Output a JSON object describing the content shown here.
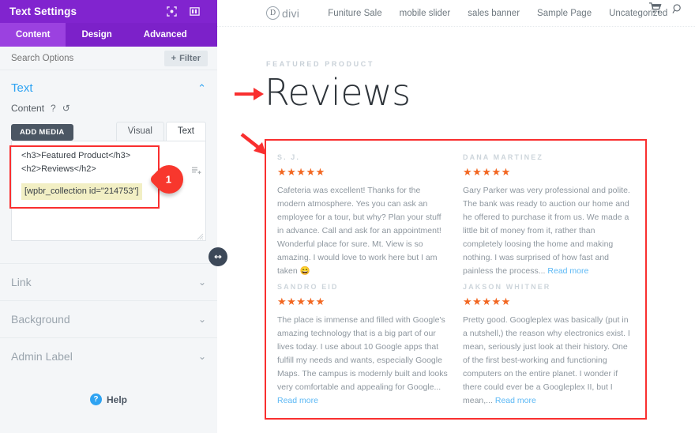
{
  "settings_panel": {
    "title": "Text Settings",
    "header_icons": [
      {
        "name": "focus-target-icon"
      },
      {
        "name": "split-panel-icon"
      }
    ],
    "tabs": [
      {
        "label": "Content",
        "active": true
      },
      {
        "label": "Design",
        "active": false
      },
      {
        "label": "Advanced",
        "active": false
      }
    ],
    "search": {
      "placeholder": "Search Options",
      "value": ""
    },
    "filter_button": {
      "label": "Filter",
      "plus": "+"
    },
    "text_section": {
      "title": "Text",
      "collapse_chevron": "⌃",
      "content_label": "Content",
      "help_mark": "?",
      "undo_mark": "↺",
      "add_media_label": "ADD MEDIA",
      "editor_tabs": [
        {
          "label": "Visual",
          "active": false
        },
        {
          "label": "Text",
          "active": true
        }
      ],
      "code_lines": [
        "<h3>Featured Product</h3>",
        "<h2>Reviews</h2>"
      ],
      "shortcode": "[wpbr_collection id=\"214753\"]",
      "annotation_badge": "1"
    },
    "accordion": [
      {
        "label": "Link",
        "chevron": "⌄"
      },
      {
        "label": "Background",
        "chevron": "⌄"
      },
      {
        "label": "Admin Label",
        "chevron": "⌄"
      }
    ],
    "help": {
      "icon_label": "?",
      "label": "Help"
    }
  },
  "page": {
    "logo": {
      "mark": "D",
      "text": "divi"
    },
    "nav_items": [
      "Funiture Sale",
      "mobile slider",
      "sales banner",
      "Sample Page",
      "Uncategorized"
    ],
    "nav_icons": [
      {
        "name": "cart-icon"
      },
      {
        "name": "search-icon"
      }
    ],
    "eyebrow": "FEATURED PRODUCT",
    "title": "Reviews",
    "reviews": [
      {
        "author": "S. J.",
        "stars": "★★★★★",
        "rating": 5,
        "body": "Cafeteria was excellent! Thanks for the modern atmosphere. Yes you can ask an employee for a tour, but why? Plan your stuff in advance. Call and ask for an appointment! Wonderful place for sure. Mt. View is so amazing. I would love to work here but I am taken 😄",
        "read_more": ""
      },
      {
        "author": "DANA MARTINEZ",
        "stars": "★★★★★",
        "rating": 5,
        "body": "Gary Parker was very professional and polite. The bank was ready to auction our home and he offered to purchase it from us. We made a little bit of money from it, rather than completely loosing the home and making nothing. I was surprised of how fast and painless the process...",
        "read_more": "Read more"
      },
      {
        "author": "SANDRO EID",
        "stars": "★★★★★",
        "rating": 5,
        "body": "The place is immense and filled with Google's amazing technology that is a big part of our lives today. I use about 10 Google apps that fulfill my needs and wants, especially Google Maps. The campus is modernly built and looks very comfortable and appealing for Google...",
        "read_more": "Read more"
      },
      {
        "author": "JAKSON WHITNER",
        "stars": "★★★★★",
        "rating": 5,
        "body": "Pretty good. Googleplex was basically (put in a nutshell,) the reason why electronics exist. I mean, seriously just look at their history. One of the first best-working and functioning computers on the entire planet. I wonder if there could ever be a Googleplex II, but I mean,...",
        "read_more": "Read more"
      }
    ]
  },
  "colors": {
    "panel_header_purple": "#8124cf",
    "tab_active_purple": "#9b41e0",
    "annotation_red": "#f92f2f",
    "star_orange": "#f26722",
    "link_blue": "#5bb8f5",
    "accent_blue": "#2ea3f2"
  }
}
